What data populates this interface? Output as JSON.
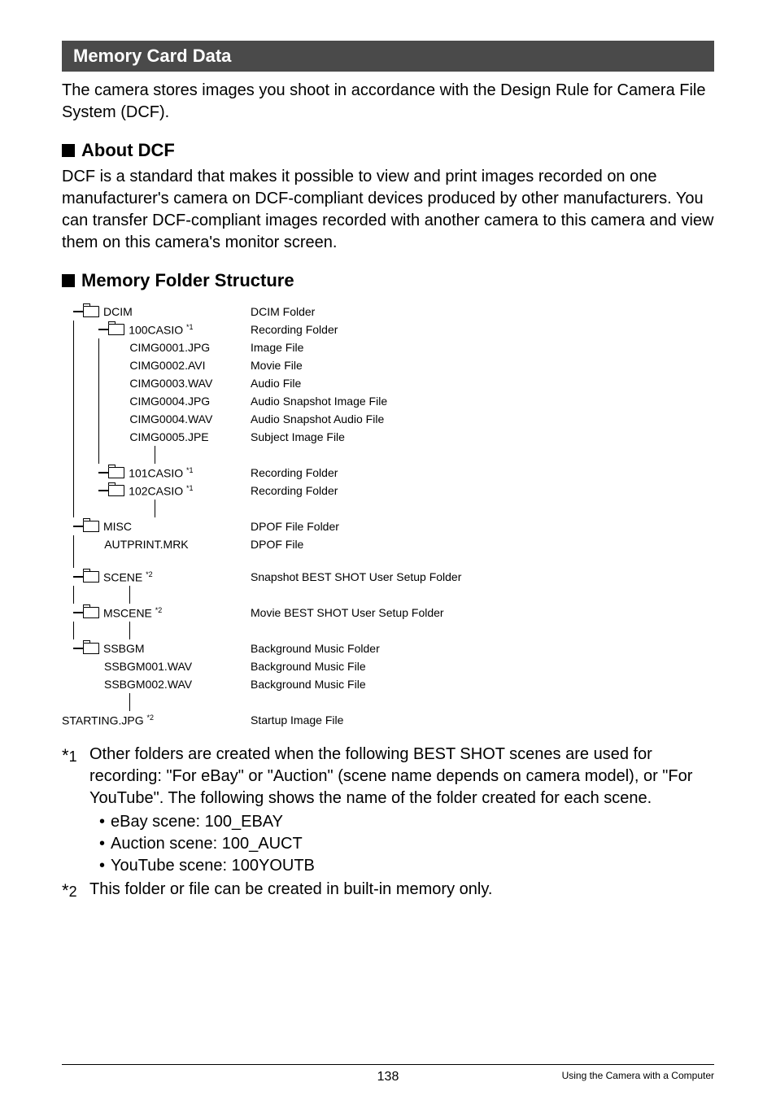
{
  "section_header": "Memory Card Data",
  "intro": "The camera stores images you shoot in accordance with the Design Rule for Camera File System (DCF).",
  "about_dcf_heading": "About DCF",
  "about_dcf_body": "DCF is a standard that makes it possible to view and print images recorded on one manufacturer's camera on DCF-compliant devices produced by other manufacturers. You can transfer DCF-compliant images recorded with another camera to this camera and view them on this camera's monitor screen.",
  "mfs_heading": "Memory Folder Structure",
  "tree": {
    "dcim": "DCIM",
    "dcim_desc": "DCIM Folder",
    "f100": "100CASIO",
    "f100_sup": "*1",
    "f100_desc": "Recording Folder",
    "c1": "CIMG0001.JPG",
    "c1d": "Image File",
    "c2": "CIMG0002.AVI",
    "c2d": "Movie File",
    "c3": "CIMG0003.WAV",
    "c3d": "Audio File",
    "c4": "CIMG0004.JPG",
    "c4d": "Audio Snapshot Image File",
    "c5": "CIMG0004.WAV",
    "c5d": "Audio Snapshot Audio File",
    "c6": "CIMG0005.JPE",
    "c6d": "Subject Image File",
    "f101": "101CASIO",
    "f101_sup": "*1",
    "f101_desc": "Recording Folder",
    "f102": "102CASIO",
    "f102_sup": "*1",
    "f102_desc": "Recording Folder",
    "misc": "MISC",
    "misc_desc": "DPOF File Folder",
    "aut": "AUTPRINT.MRK",
    "aut_desc": "DPOF File",
    "scene": "SCENE",
    "scene_sup": "*2",
    "scene_desc": "Snapshot BEST SHOT User Setup Folder",
    "mscene": "MSCENE",
    "mscene_sup": "*2",
    "mscene_desc": "Movie BEST SHOT User Setup Folder",
    "ssbgm": "SSBGM",
    "ssbgm_desc": "Background Music Folder",
    "ss1": "SSBGM001.WAV",
    "ss1d": "Background Music File",
    "ss2": "SSBGM002.WAV",
    "ss2d": "Background Music File",
    "start": "STARTING.JPG",
    "start_sup": "*2",
    "start_desc": "Startup Image File"
  },
  "fn1_mark_star": "*",
  "fn1_mark_num": "1",
  "fn1_text": "Other folders are created when the following BEST SHOT scenes are used for recording: \"For eBay\" or \"Auction\" (scene name depends on camera model), or \"For YouTube\". The following shows the name of the folder created for each scene.",
  "bullets": {
    "b1": "eBay scene: 100_EBAY",
    "b2": "Auction scene: 100_AUCT",
    "b3": "YouTube scene: 100YOUTB"
  },
  "fn2_mark_star": "*",
  "fn2_mark_num": "2",
  "fn2_text": "This folder or file can be created in built-in memory only.",
  "footer_page": "138",
  "footer_text": "Using the Camera with a Computer"
}
